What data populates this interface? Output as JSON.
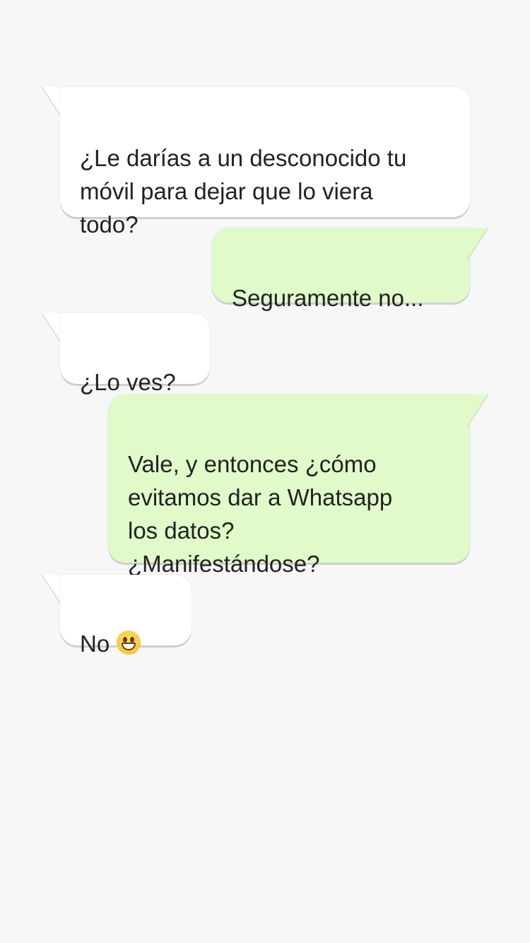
{
  "messages": [
    {
      "direction": "incoming",
      "text": "¿Le darías a un desconocido tu\nmóvil para dejar que lo viera\ntodo?"
    },
    {
      "direction": "outgoing",
      "text": "Seguramente no..."
    },
    {
      "direction": "incoming",
      "text": "¿Lo ves?"
    },
    {
      "direction": "outgoing",
      "text": "Vale, y entonces ¿cómo\nevitamos dar a Whatsapp\nlos datos?\n¿Manifestándose?"
    },
    {
      "direction": "incoming",
      "text": "No",
      "emoji": "grinning-face-icon"
    }
  ],
  "colors": {
    "background": "#f7f7f7",
    "incoming_bubble": "#ffffff",
    "outgoing_bubble": "#e0fac9",
    "text": "#222222"
  }
}
